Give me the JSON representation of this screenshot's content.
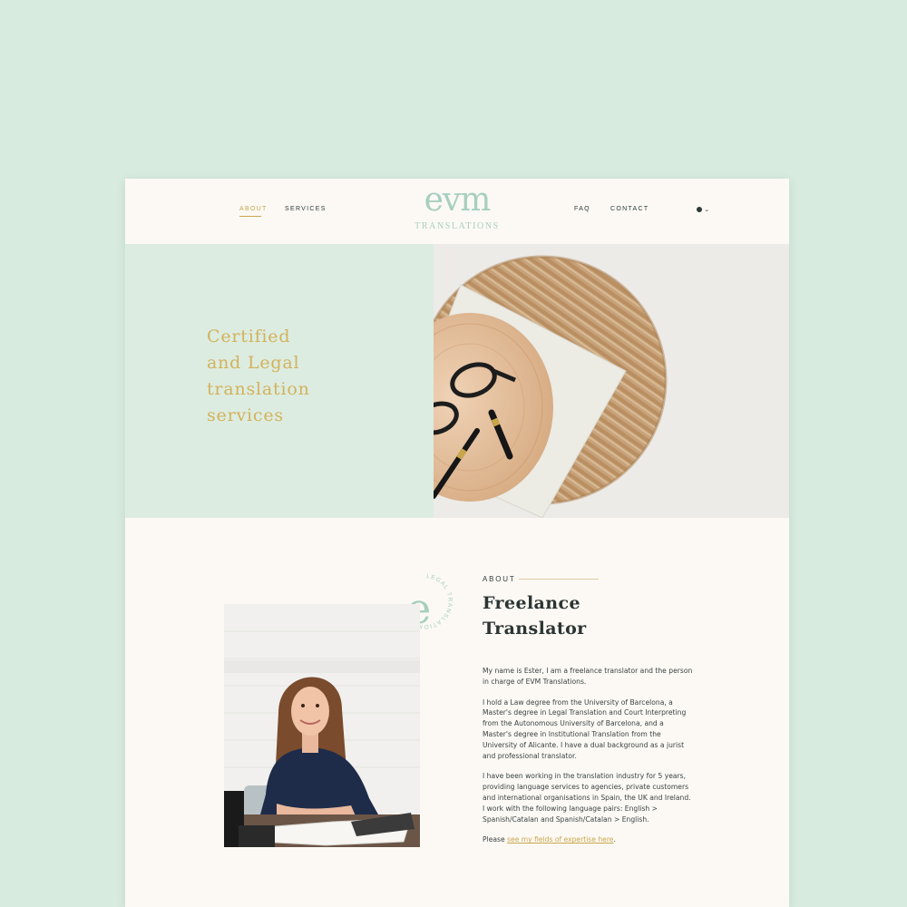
{
  "header": {
    "nav_left": [
      "ABOUT",
      "SERVICES"
    ],
    "nav_right": [
      "FAQ",
      "CONTACT"
    ],
    "logo_mark": "evm",
    "logo_sub": "TRANSLATIONS",
    "lang_chevron": "⌄",
    "active": "ABOUT"
  },
  "hero": {
    "title": "Certified\nand Legal\ntranslation\nservices"
  },
  "badge": {
    "letter": "e",
    "ring_text": "LEGAL TRANSLATIONS"
  },
  "about": {
    "label": "ABOUT",
    "heading": "Freelance\nTranslator",
    "p1": "My name is Ester, I am a freelance translator and the person in charge of EVM Translations.",
    "p2": "I hold a Law degree from the University of Barcelona, a Master's degree in Legal Translation and Court Interpreting from the Autonomous University of Barcelona, and a Master's degree in Institutional Translation from the University of Alicante. I have a dual background as a jurist and professional translator.",
    "p3": "I have been working in the translation industry for 5 years, providing language services to agencies, private customers and international organisations in Spain, the UK and Ireland. I work with the following language pairs: English > Spanish/Catalan and Spanish/Catalan > English.",
    "p4_prefix": "Please ",
    "p4_link": "see my fields of expertise here",
    "p4_suffix": "."
  },
  "colors": {
    "background": "#d7ebdf",
    "card": "#fcf9f4",
    "mint": "#dcece0",
    "gold": "#d3b25c",
    "logo": "#a8cfbe",
    "ink": "#2b3433"
  },
  "icons": [
    "globe-icon",
    "chevron-down-icon"
  ]
}
